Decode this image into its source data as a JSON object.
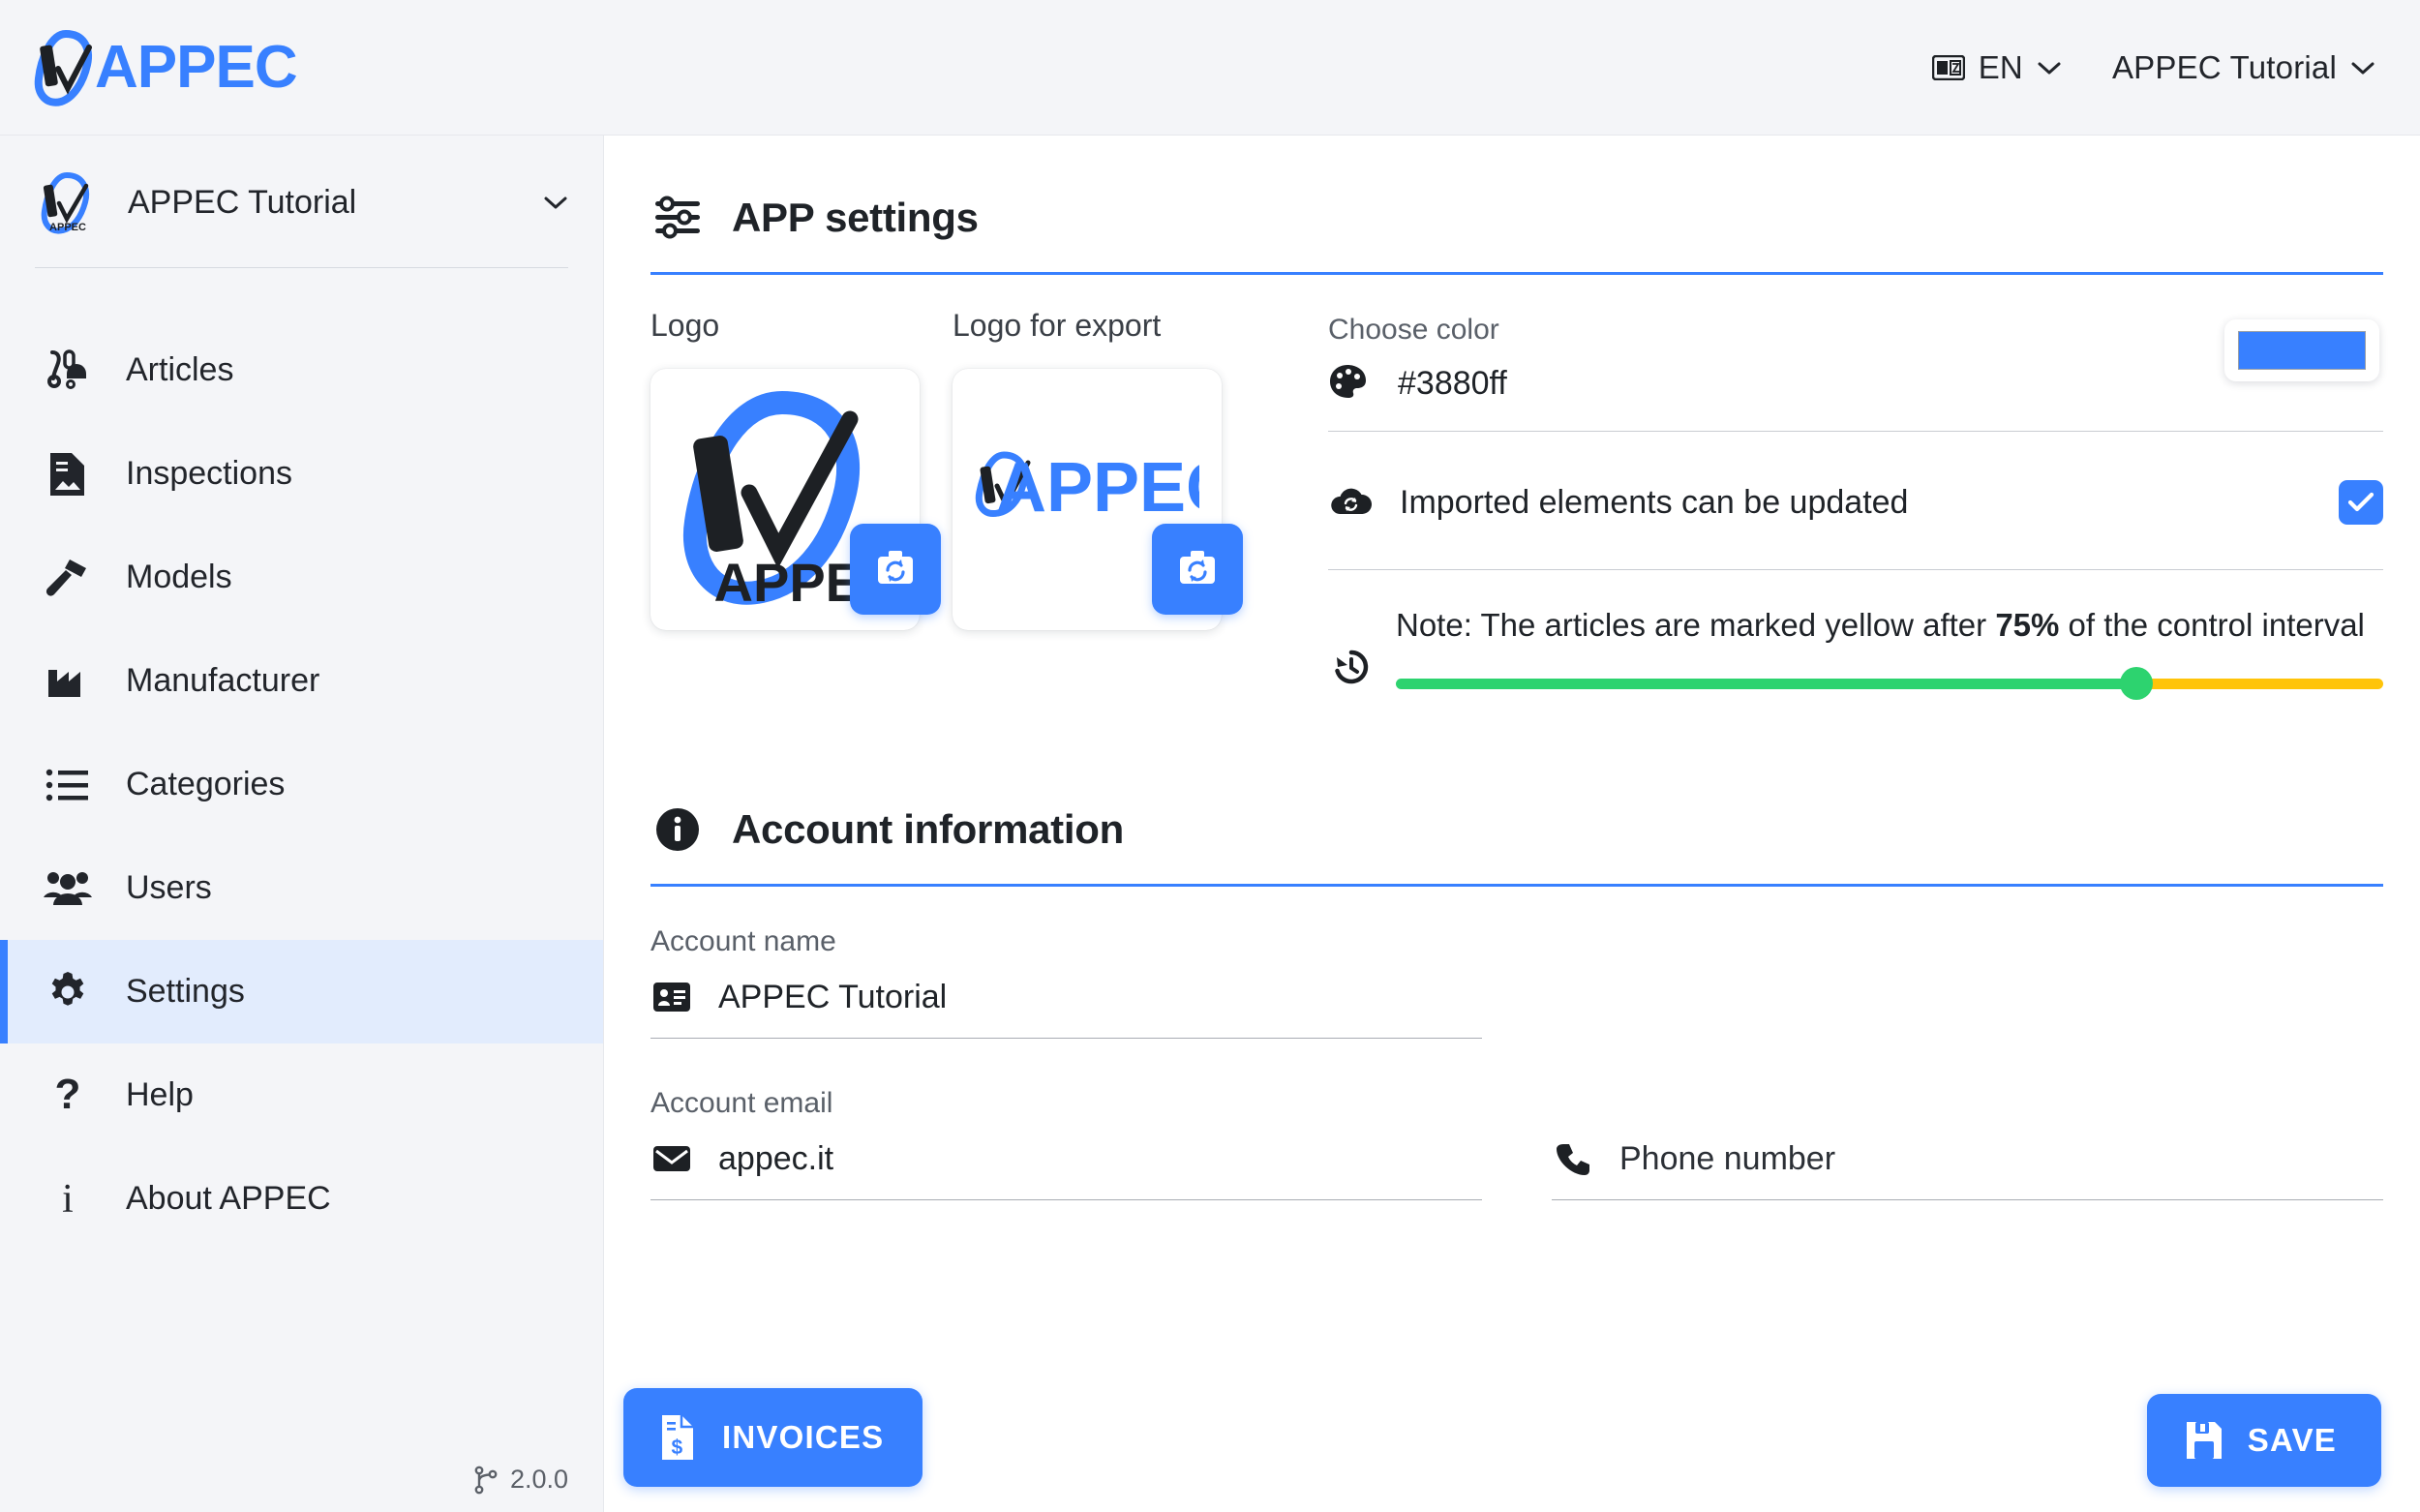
{
  "brand": {
    "name": "APPEC",
    "logo_icon": "appec-carabiner-logo"
  },
  "header": {
    "language": {
      "icon": "translate-icon",
      "label": "EN",
      "chevron": "chevron-down-icon"
    },
    "account": {
      "label": "APPEC Tutorial",
      "chevron": "chevron-down-icon"
    }
  },
  "sidebar": {
    "account": {
      "label": "APPEC Tutorial",
      "logo_icon": "appec-carabiner-logo",
      "chevron": "chevron-down-icon"
    },
    "items": [
      {
        "label": "Articles",
        "icon": "carabiner-helmet-icon",
        "active": false
      },
      {
        "label": "Inspections",
        "icon": "document-image-icon",
        "active": false
      },
      {
        "label": "Models",
        "icon": "hammer-icon",
        "active": false
      },
      {
        "label": "Manufacturer",
        "icon": "factory-icon",
        "active": false
      },
      {
        "label": "Categories",
        "icon": "list-icon",
        "active": false
      },
      {
        "label": "Users",
        "icon": "people-icon",
        "active": false
      },
      {
        "label": "Settings",
        "icon": "gear-icon",
        "active": true
      },
      {
        "label": "Help",
        "icon": "question-mark-icon",
        "active": false
      },
      {
        "label": "About APPEC",
        "icon": "info-letter-icon",
        "active": false
      }
    ],
    "version": {
      "icon": "git-branch-icon",
      "label": "2.0.0"
    }
  },
  "app_settings": {
    "title": "APP settings",
    "title_icon": "sliders-icon",
    "logo": {
      "caption": "Logo",
      "upload_icon": "camera-refresh-icon"
    },
    "logo_export": {
      "caption": "Logo for export",
      "upload_icon": "camera-refresh-icon"
    },
    "color": {
      "label": "Choose color",
      "icon": "palette-icon",
      "value": "#3880ff",
      "swatch_color": "#3880ff"
    },
    "imported": {
      "label": "Imported elements can be updated",
      "icon": "cloud-sync-icon",
      "checked": true
    },
    "interval": {
      "icon": "history-icon",
      "note_prefix": "Note: The articles are marked yellow after ",
      "note_value": "75%",
      "note_suffix": " of the control interval",
      "percent": 75,
      "filled_color": "#2dd36f",
      "remainder_color": "#ffc409"
    }
  },
  "account_information": {
    "title": "Account information",
    "title_icon": "info-circle-icon",
    "fields": {
      "account_name": {
        "label": "Account name",
        "icon": "id-card-icon",
        "value": "APPEC Tutorial"
      },
      "account_email": {
        "label": "Account email",
        "icon": "mail-icon",
        "value": "appec.it"
      },
      "phone_number": {
        "label": "",
        "icon": "phone-icon",
        "placeholder": "Phone number",
        "value": ""
      }
    }
  },
  "actions": {
    "invoices": {
      "label": "INVOICES",
      "icon": "invoice-icon"
    },
    "save": {
      "label": "SAVE",
      "icon": "floppy-disk-icon"
    }
  }
}
